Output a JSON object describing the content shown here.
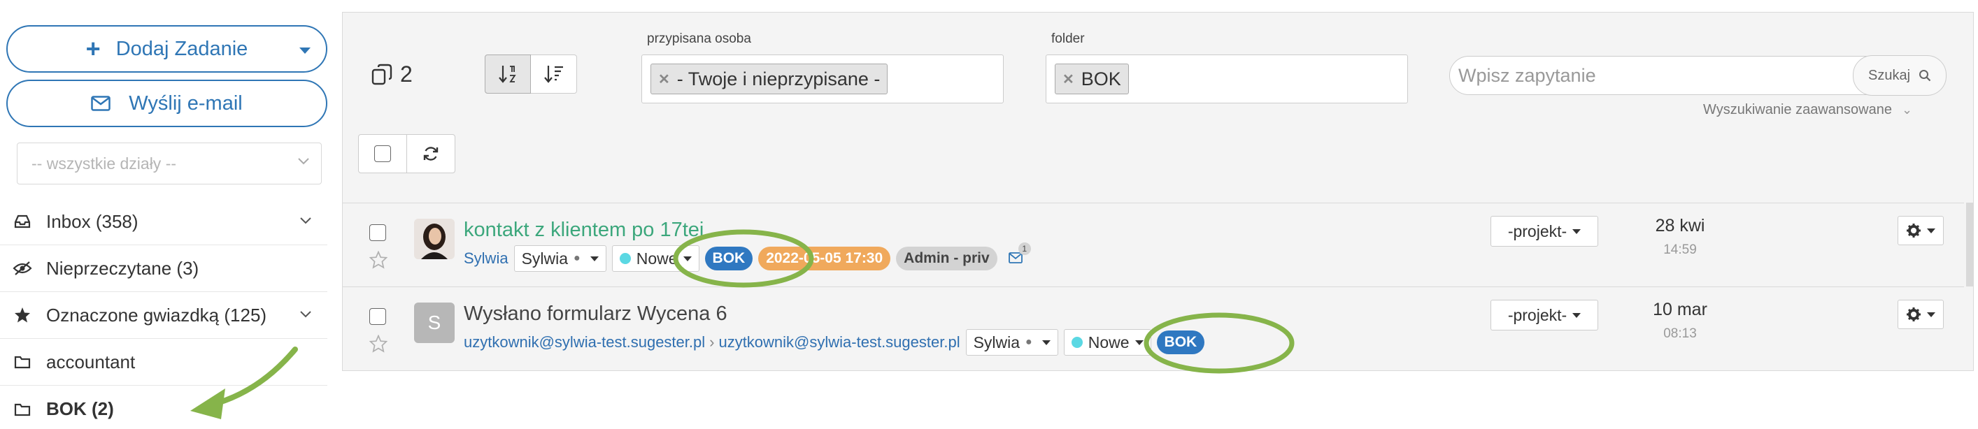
{
  "sidebar": {
    "add_task_label": "Dodaj Zadanie",
    "send_email_label": "Wyślij e-mail",
    "department_placeholder": "-- wszystkie działy --",
    "items": [
      {
        "label": "Inbox (358)",
        "icon": "inbox-icon"
      },
      {
        "label": "Nieprzeczytane (3)",
        "icon": "eye-slash-icon"
      },
      {
        "label": "Oznaczone gwiazdką (125)",
        "icon": "star-icon"
      },
      {
        "label": "accountant",
        "icon": "folder-icon"
      },
      {
        "label": "BOK (2)",
        "icon": "folder-icon"
      }
    ]
  },
  "toolbar": {
    "count": "2",
    "assigned_label": "przypisana osoba",
    "assigned_chip": "- Twoje i nieprzypisane -",
    "folder_label": "folder",
    "folder_chip": "BOK",
    "search_placeholder": "Wpisz zapytanie",
    "search_button": "Szukaj",
    "advanced_search": "Wyszukiwanie zaawansowane"
  },
  "tasks": [
    {
      "subject": "kontakt z klientem po 17tej",
      "sender": "Sylwia",
      "assignee": "Sylwia",
      "status": "Nowe",
      "folder_badge": "BOK",
      "deadline": "2022-05-05 17:30",
      "tag": "Admin - priv",
      "mail_count": "1",
      "project": "-projekt-",
      "date": "28 kwi",
      "time": "14:59"
    },
    {
      "subject": "Wysłano formularz Wycena 6",
      "avatar_letter": "S",
      "from": "uzytkownik@sylwia-test.sugester.pl",
      "to": "uzytkownik@sylwia-test.sugester.pl",
      "assignee": "Sylwia",
      "status": "Nowe",
      "folder_badge": "BOK",
      "project": "-projekt-",
      "date": "10 mar",
      "time": "08:13"
    }
  ],
  "colors": {
    "primary": "#2f76b5",
    "subject_green": "#3ca77c",
    "badge_blue": "#2f78c1",
    "badge_orange": "#f0a95c",
    "status_dot": "#5bd8e3",
    "annotation_green": "#86b44a"
  }
}
